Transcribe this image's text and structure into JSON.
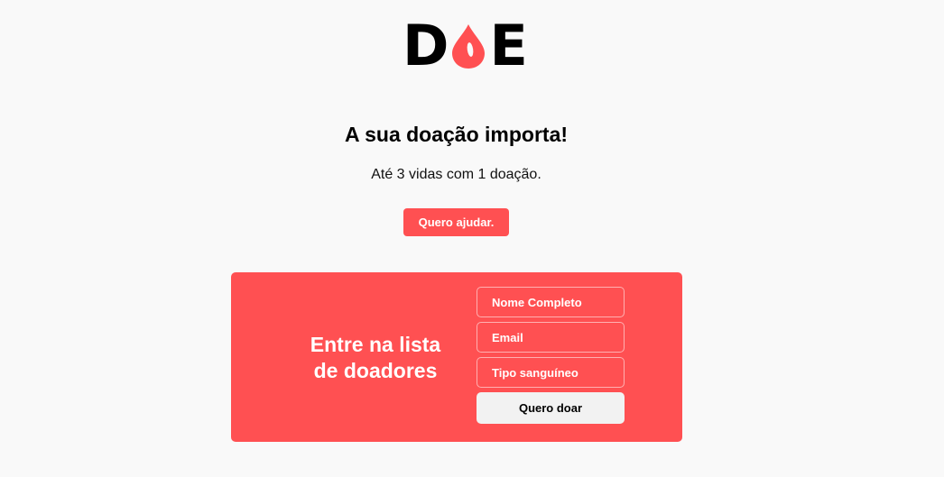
{
  "logo": {
    "left_letter": "D",
    "right_letter": "E",
    "drop_icon": "blood-drop-icon",
    "drop_color": "#ff5052"
  },
  "hero": {
    "headline": "A sua doação importa!",
    "subline": "Até 3 vidas com 1 doação.",
    "help_button_label": "Quero ajudar."
  },
  "form": {
    "title_line1": "Entre na lista",
    "title_line2": "de doadores",
    "name_placeholder": "Nome Completo",
    "email_placeholder": "Email",
    "blood_type_placeholder": "Tipo sanguíneo",
    "submit_label": "Quero doar"
  },
  "colors": {
    "accent": "#ff5052",
    "background": "#f9f9f9",
    "submit_background": "#f2f2f2"
  }
}
